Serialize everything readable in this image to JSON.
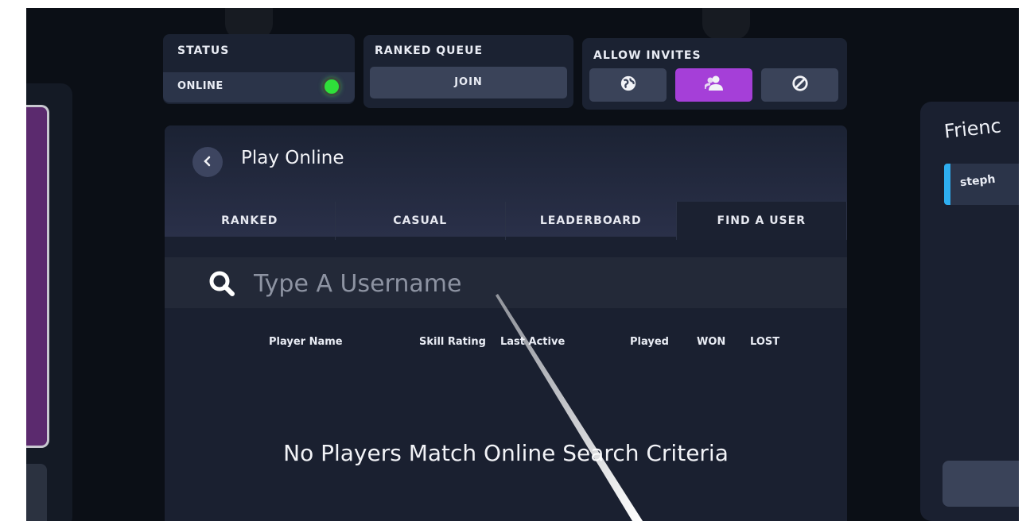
{
  "status": {
    "label": "STATUS",
    "value": "ONLINE"
  },
  "ranked_queue": {
    "label": "RANKED QUEUE",
    "join_label": "JOIN"
  },
  "allow_invites": {
    "label": "ALLOW INVITES",
    "options": [
      {
        "icon": "globe-icon"
      },
      {
        "icon": "friends-icon",
        "active": true
      },
      {
        "icon": "block-icon"
      }
    ]
  },
  "main": {
    "title": "Play Online",
    "tabs": [
      "RANKED",
      "CASUAL",
      "LEADERBOARD",
      "FIND A USER"
    ],
    "active_tab": "FIND A USER",
    "search": {
      "placeholder": "Type A Username",
      "value": ""
    },
    "columns": [
      "Player Name",
      "Skill Rating",
      "Last Active",
      "Played",
      "WON",
      "LOST"
    ],
    "empty_message": "No Players Match Online Search Criteria"
  },
  "friends": {
    "title": "Frienc",
    "items": [
      {
        "name": "steph"
      }
    ]
  },
  "colors": {
    "accent": "#a53fd8",
    "online": "#2fe03a",
    "friend_stripe": "#2eaef0"
  }
}
